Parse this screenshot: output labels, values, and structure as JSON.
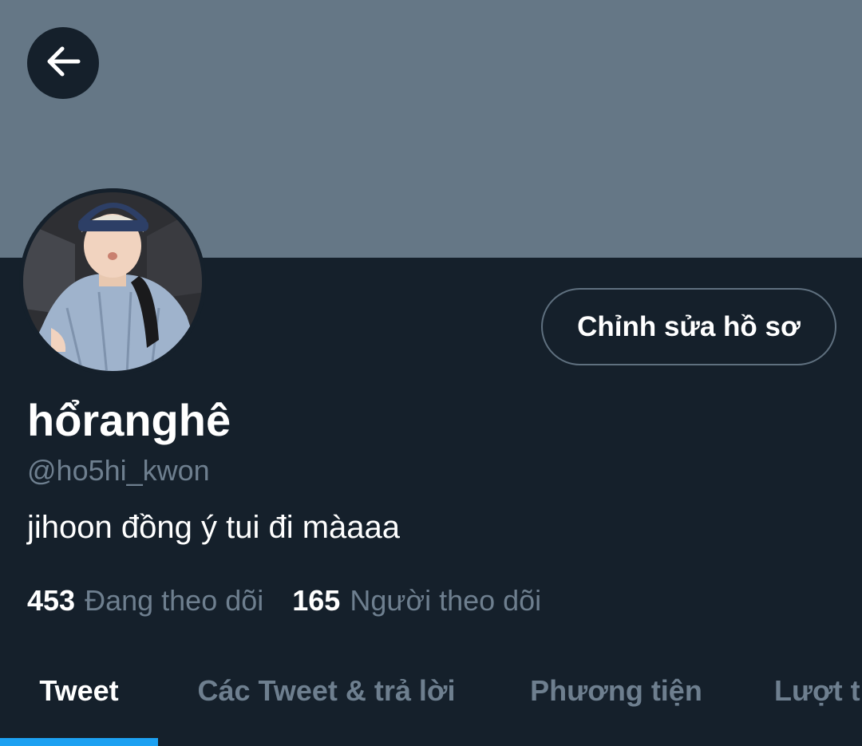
{
  "header": {
    "back_icon": "arrow-left-icon",
    "banner_color": "#657786"
  },
  "profile": {
    "display_name": "hổranghê",
    "handle": "@ho5hi_kwon",
    "bio": "jihoon đồng ý tui đi màaaa",
    "edit_button_label": "Chỉnh sửa hồ sơ"
  },
  "stats": {
    "following_count": "453",
    "following_label": "Đang theo dõi",
    "followers_count": "165",
    "followers_label": "Người theo dõi"
  },
  "tabs": [
    {
      "label": "Tweet",
      "active": true
    },
    {
      "label": "Các Tweet & trả lời",
      "active": false
    },
    {
      "label": "Phương tiện",
      "active": false
    },
    {
      "label": "Lượt thích",
      "active": false
    }
  ],
  "colors": {
    "background": "#15202b",
    "accent": "#1da1f2",
    "secondary_text": "#6e7f8f"
  }
}
